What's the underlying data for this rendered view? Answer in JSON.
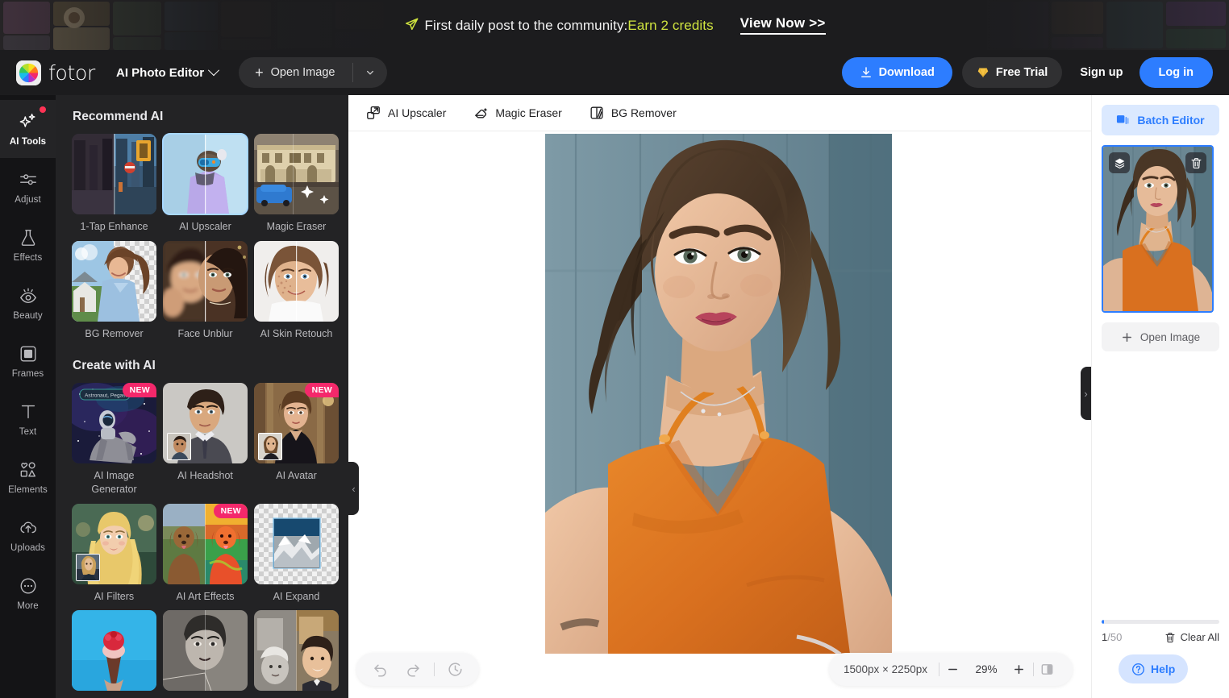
{
  "promo": {
    "message_prefix": "First daily post to the community:",
    "message_highlight": "Earn 2 credits",
    "cta": "View Now >>",
    "icon": "send-icon",
    "highlight_color": "#cfe33f"
  },
  "header": {
    "brand": "fotor",
    "app_name": "AI Photo Editor",
    "open_image": "Open Image",
    "download": "Download",
    "free_trial": "Free Trial",
    "sign_up": "Sign up",
    "log_in": "Log in",
    "accent_color": "#2d7dff"
  },
  "rail": {
    "items": [
      {
        "label": "AI Tools",
        "icon": "sparkles-icon",
        "active": true,
        "badge": true
      },
      {
        "label": "Adjust",
        "icon": "sliders-icon",
        "active": false,
        "badge": false
      },
      {
        "label": "Effects",
        "icon": "flask-icon",
        "active": false,
        "badge": false
      },
      {
        "label": "Beauty",
        "icon": "eye-icon",
        "active": false,
        "badge": false
      },
      {
        "label": "Frames",
        "icon": "frame-icon",
        "active": false,
        "badge": false
      },
      {
        "label": "Text",
        "icon": "text-t-icon",
        "active": false,
        "badge": false
      },
      {
        "label": "Elements",
        "icon": "shapes-icon",
        "active": false,
        "badge": false
      },
      {
        "label": "Uploads",
        "icon": "cloud-up-icon",
        "active": false,
        "badge": false
      },
      {
        "label": "More",
        "icon": "dots-icon",
        "active": false,
        "badge": false
      }
    ]
  },
  "panel": {
    "sections": [
      {
        "title": "Recommend AI",
        "cards": [
          {
            "label": "1-Tap Enhance",
            "badge": "",
            "selected": false
          },
          {
            "label": "AI Upscaler",
            "badge": "",
            "selected": true
          },
          {
            "label": "Magic Eraser",
            "badge": "",
            "selected": false
          },
          {
            "label": "BG Remover",
            "badge": "",
            "selected": false
          },
          {
            "label": "Face Unblur",
            "badge": "",
            "selected": false
          },
          {
            "label": "AI Skin Retouch",
            "badge": "",
            "selected": false
          }
        ]
      },
      {
        "title": "Create with AI",
        "cards": [
          {
            "label": "AI Image Generator",
            "badge": "NEW",
            "selected": false
          },
          {
            "label": "AI Headshot",
            "badge": "",
            "selected": false
          },
          {
            "label": "AI Avatar",
            "badge": "NEW",
            "selected": false
          },
          {
            "label": "AI Filters",
            "badge": "",
            "selected": false
          },
          {
            "label": "AI Art Effects",
            "badge": "NEW",
            "selected": false
          },
          {
            "label": "AI Expand",
            "badge": "",
            "selected": false
          }
        ]
      }
    ],
    "badge_color": "#f4286b"
  },
  "canvas": {
    "tools": [
      {
        "label": "AI Upscaler",
        "icon": "upscale-icon"
      },
      {
        "label": "Magic Eraser",
        "icon": "eraser-icon"
      },
      {
        "label": "BG Remover",
        "icon": "bg-remove-icon"
      }
    ],
    "collapse_left": "‹",
    "collapse_right": "›",
    "history": {
      "undo": "undo-icon",
      "redo": "redo-icon",
      "history": "history-clock-icon"
    },
    "zoom": {
      "dimensions": "1500px × 2250px",
      "minus": "−",
      "level": "29%",
      "plus": "+",
      "compare": "compare-split-icon"
    }
  },
  "right_panel": {
    "batch_editor": "Batch Editor",
    "thumb_layers_icon": "layers-icon",
    "thumb_delete_icon": "trash-icon",
    "open_image": "Open Image",
    "progress_percent": 2,
    "count_current": "1",
    "count_total": "/50",
    "clear_all": "Clear All",
    "help": "Help",
    "accent_color": "#2d7dff"
  }
}
